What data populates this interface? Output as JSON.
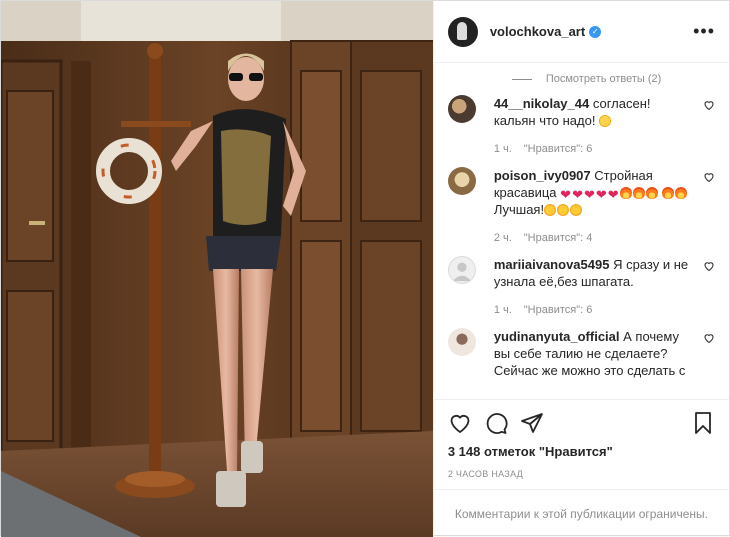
{
  "post": {
    "username": "volochkova_art",
    "more_icon": "more-options-icon",
    "verified_icon": "verified-badge-icon"
  },
  "comments": {
    "view_replies": "Посмотреть ответы (2)",
    "items": [
      {
        "username": "44__nikolay_44",
        "text": "согласен! кальян что надо!",
        "time": "1 ч.",
        "likes": "\"Нравится\": 6",
        "avatar_color": "#4a3a30"
      },
      {
        "username": "poison_ivy0907",
        "text_1": "Стройная красавица",
        "text_2": "Лучшая!",
        "time": "2 ч.",
        "likes": "\"Нравится\": 4",
        "avatar_color": "#b58b5a"
      },
      {
        "username": "mariiaivanova5495",
        "text": "Я сразу и не узнала её,без шпагата.",
        "time": "1 ч.",
        "likes": "\"Нравится\": 6",
        "avatar_color": "#dbdbdb"
      },
      {
        "username": "yudinanyuta_official",
        "text": "А почему вы себе талию не сделаете? Сейчас же можно это сделать с",
        "avatar_color": "#d8cfc8"
      }
    ]
  },
  "actions": {
    "like_icon": "heart-icon",
    "comment_icon": "comment-icon",
    "share_icon": "share-icon",
    "save_icon": "bookmark-icon"
  },
  "likes_text": "3 148 отметок \"Нравится\"",
  "timestamp": "2 часов назад",
  "comments_closed": "Комментарии к этой публикации ограничены.",
  "colors": {
    "accent": "#3897f0",
    "muted": "#8e8e8e",
    "text": "#262626"
  }
}
